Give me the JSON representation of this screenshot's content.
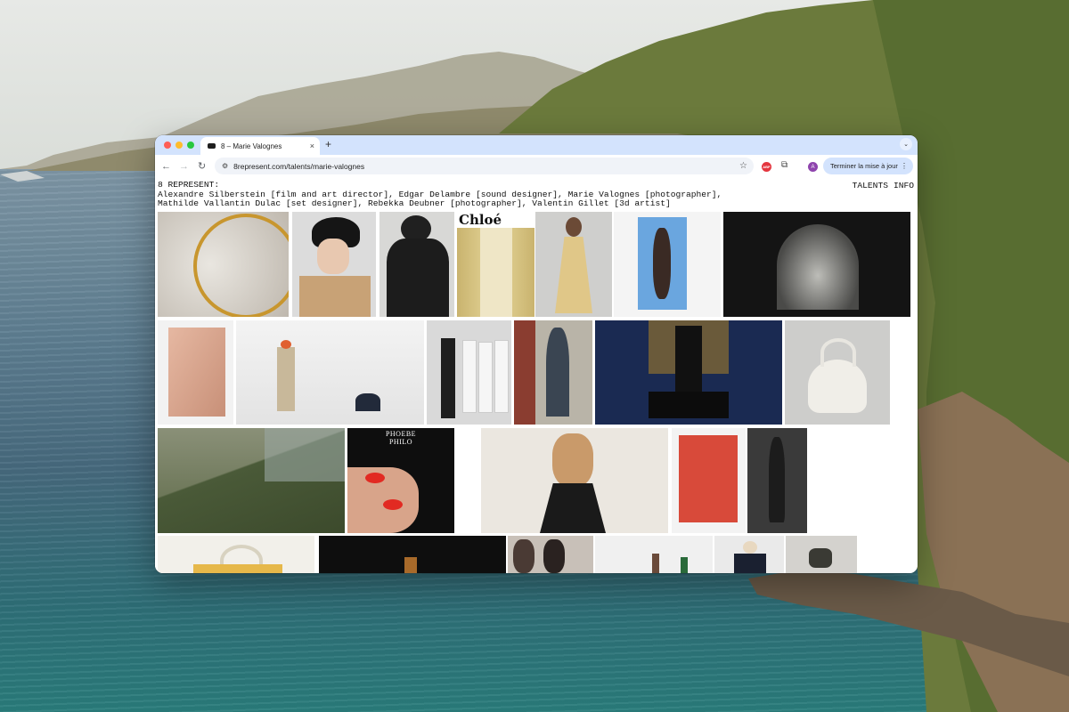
{
  "browser": {
    "tab_title": "8 – Marie Valognes",
    "tab_close": "×",
    "new_tab": "+",
    "tab_menu": "⌄",
    "url": "8represent.com/talents/marie-valognes",
    "site_info_icon": "⚙",
    "back": "←",
    "forward": "→",
    "reload": "↻",
    "star": "☆",
    "abp_label": "ABP",
    "extensions_icon": "⧉",
    "profile_initial": "A",
    "update_label": "Terminer la mise à jour",
    "update_menu": "⋮"
  },
  "page": {
    "header_line1": "8 REPRESENT:",
    "header_line2": "Alexandre Silberstein [film and art director], Edgar Delambre [sound designer], Marie Valognes [photographer],",
    "header_line3": "Mathilde Vallantin Dulac [set designer], Rebekka Deubner [photographer], Valentin Gillet [3d artist]",
    "nav": [
      "TALENTS",
      "INFO"
    ],
    "chloe_text": "Chloé",
    "phoebe_text_1": "PHOEBE",
    "phoebe_text_2": "PHILO"
  },
  "colors": {
    "tabstrip": "#d3e3fd",
    "omnibox": "#f0f3f8",
    "update_button": "#d3e3fd",
    "profile": "#8e44ad",
    "abp": "#e4363f"
  }
}
